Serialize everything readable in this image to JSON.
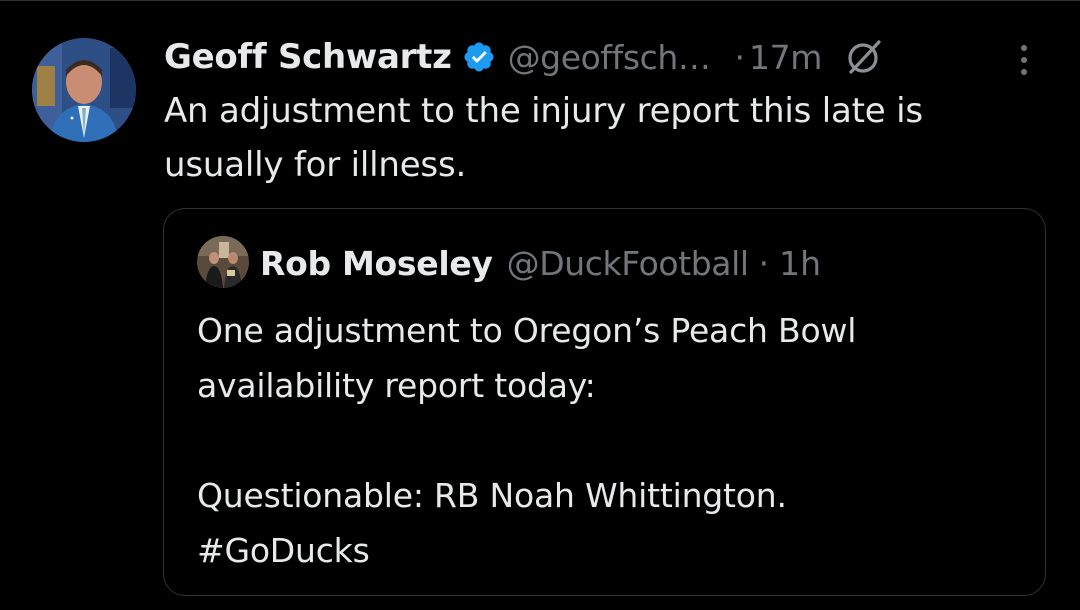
{
  "tweet": {
    "author_name": "Geoff Schwartz",
    "handle": "@geoffsch…",
    "separator": "·",
    "time": "17m",
    "text": "An adjustment to the injury report this late is usually for illness.",
    "verified_icon": "verified-badge-icon",
    "grok_icon": "grok-icon",
    "more_icon": "more-options-icon",
    "verified_color": "#1d9bf0"
  },
  "quoted_tweet": {
    "author_name": "Rob Moseley",
    "handle": "@DuckFootball",
    "separator": "·",
    "time": "1h",
    "text_line_1": "One adjustment to Oregon’s Peach Bowl availability report today:",
    "text_line_2": "Questionable: RB Noah Whittington.",
    "text_line_3": "#GoDucks"
  },
  "colors": {
    "background": "#000000",
    "primary_text": "#e7e9ea",
    "secondary_text": "#71767b",
    "border": "#2f3336"
  }
}
